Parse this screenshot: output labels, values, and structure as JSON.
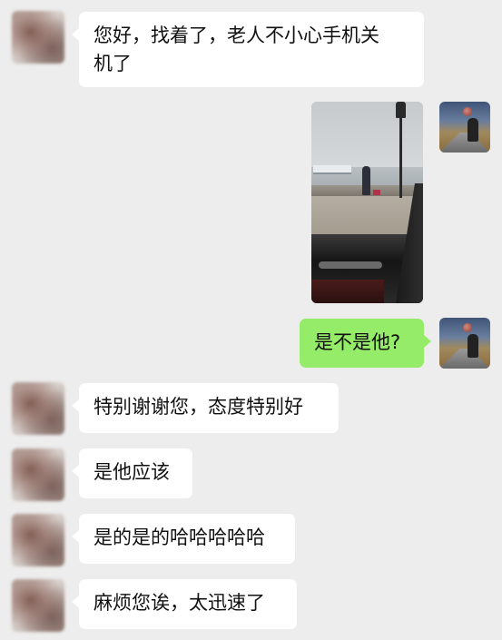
{
  "chat": {
    "messages": [
      {
        "side": "left",
        "type": "text",
        "text_lines": [
          "您好，找着了，老人不小心手机关",
          "机了"
        ]
      },
      {
        "side": "right",
        "type": "image",
        "image_desc": "photo"
      },
      {
        "side": "right",
        "type": "text",
        "text": "是不是他?"
      },
      {
        "side": "left",
        "type": "text",
        "text": "特别谢谢您，态度特别好"
      },
      {
        "side": "left",
        "type": "text",
        "text": "是他应该"
      },
      {
        "side": "left",
        "type": "text",
        "text": "是的是的哈哈哈哈哈"
      },
      {
        "side": "left",
        "type": "text",
        "text": "麻烦您诶，太迅速了"
      }
    ]
  },
  "colors": {
    "background": "#ededed",
    "left_bubble": "#ffffff",
    "right_bubble": "#95ec69"
  }
}
